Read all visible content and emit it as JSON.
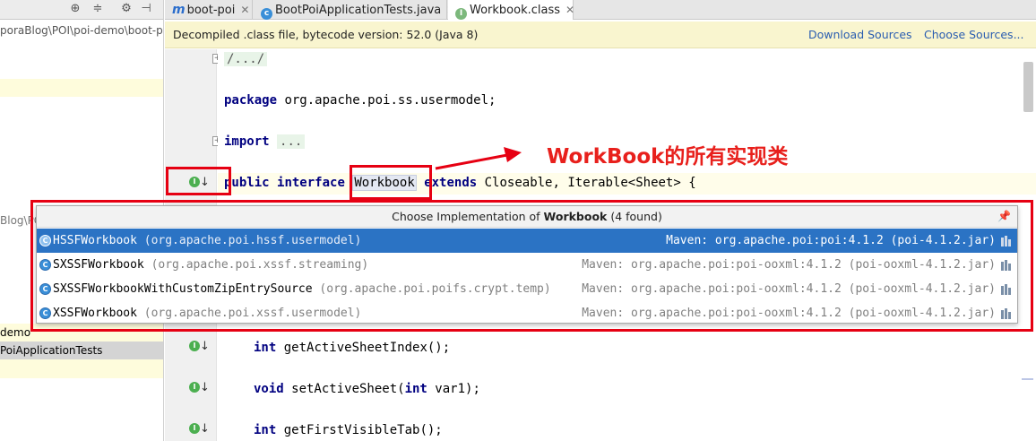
{
  "left_panel": {
    "toolbar_icons": [
      "target-icon",
      "collapse-icon",
      "gear-icon",
      "hide-icon"
    ],
    "path_text": "poraBlog\\POI\\poi-demo\\boot-p",
    "path_text_2": "Blog\\POI",
    "demo_item": "demo",
    "tests_item": "PoiApplicationTests"
  },
  "tabs": [
    {
      "label": "boot-poi",
      "icon": "maven-icon",
      "closable": true
    },
    {
      "label": "BootPoiApplicationTests.java",
      "icon": "java-class-icon",
      "closable": true
    },
    {
      "label": "Workbook.class",
      "icon": "interface-icon",
      "closable": true,
      "active": true
    }
  ],
  "banner": {
    "text": "Decompiled .class file, bytecode version: 52.0 (Java 8)",
    "download_sources": "Download Sources",
    "choose_sources": "Choose Sources..."
  },
  "code": {
    "line1_fold": "/.../",
    "package_kw": "package",
    "package_name": " org.apache.poi.ss.usermodel;",
    "import_kw": "import",
    "import_fold": "...",
    "decl_public": "public",
    "decl_interface": "interface",
    "decl_name": "Workbook",
    "decl_extends": "extends",
    "decl_rest": " Closeable, Iterable<Sheet> {",
    "m1_type": "int",
    "m1_rest": " getActiveSheetIndex();",
    "m2_type": "void",
    "m2_mid": " setActiveSheet(",
    "m2_param_type": "int",
    "m2_rest": " var1);",
    "m3_type": "int",
    "m3_rest": " getFirstVisibleTab();"
  },
  "annotation": {
    "text": "WorkBook的所有实现类",
    "color": "#e8201c"
  },
  "popup": {
    "title_prefix": "Choose Implementation of ",
    "title_name": "Workbook",
    "title_count": " (4 found)",
    "rows": [
      {
        "class": "HSSFWorkbook",
        "package": " (org.apache.poi.hssf.usermodel)",
        "maven": "Maven: org.apache.poi:poi:4.1.2 (poi-4.1.2.jar)",
        "selected": true
      },
      {
        "class": "SXSSFWorkbook",
        "package": " (org.apache.poi.xssf.streaming)",
        "maven": "Maven: org.apache.poi:poi-ooxml:4.1.2 (poi-ooxml-4.1.2.jar)",
        "selected": false
      },
      {
        "class": "SXSSFWorkbookWithCustomZipEntrySource",
        "package": " (org.apache.poi.poifs.crypt.temp)",
        "maven": "Maven: org.apache.poi:poi-ooxml:4.1.2 (poi-ooxml-4.1.2.jar)",
        "selected": false
      },
      {
        "class": "XSSFWorkbook",
        "package": " (org.apache.poi.xssf.usermodel)",
        "maven": "Maven: org.apache.poi:poi-ooxml:4.1.2 (poi-ooxml-4.1.2.jar)",
        "selected": false
      }
    ]
  },
  "colors": {
    "selection": "#2b73c4",
    "banner_bg": "#f9f5cf",
    "keyword": "#000080",
    "annotation_red": "#e60012"
  }
}
